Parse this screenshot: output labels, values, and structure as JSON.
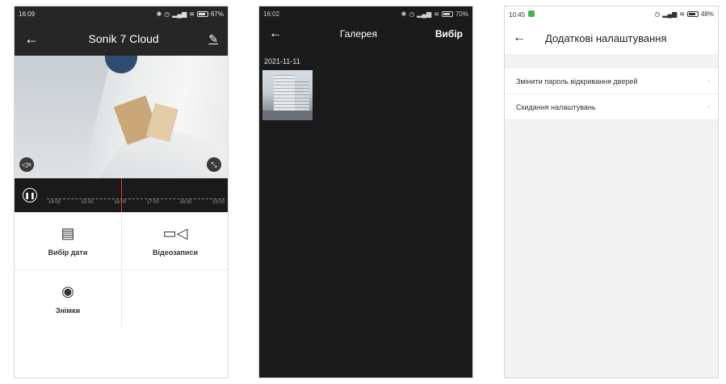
{
  "screen1": {
    "status": {
      "time": "16:09",
      "battery": "67%"
    },
    "title": "Sonik 7 Cloud",
    "timeline_labels": [
      "14:00",
      "15:00",
      "16:00",
      "17:00",
      "18:00",
      "19:00"
    ],
    "actions": [
      {
        "label": "Вибір дати",
        "icon": "calendar-icon"
      },
      {
        "label": "Відеозаписи",
        "icon": "video-camera-icon"
      },
      {
        "label": "Знімки",
        "icon": "camera-icon"
      }
    ]
  },
  "screen2": {
    "status": {
      "time": "16:02",
      "battery": "70%"
    },
    "title": "Галерея",
    "action": "Вибір",
    "date": "2021-11-11"
  },
  "screen3": {
    "status": {
      "time": "10:45",
      "battery": "48%"
    },
    "title": "Додаткові налаштування",
    "items": [
      "Змінити пароль відкривання дверей",
      "Скидання налаштувань"
    ]
  },
  "colors": {
    "dark_header": "#262626",
    "gallery_bg": "#1b1b1b",
    "playhead": "#e53935"
  }
}
